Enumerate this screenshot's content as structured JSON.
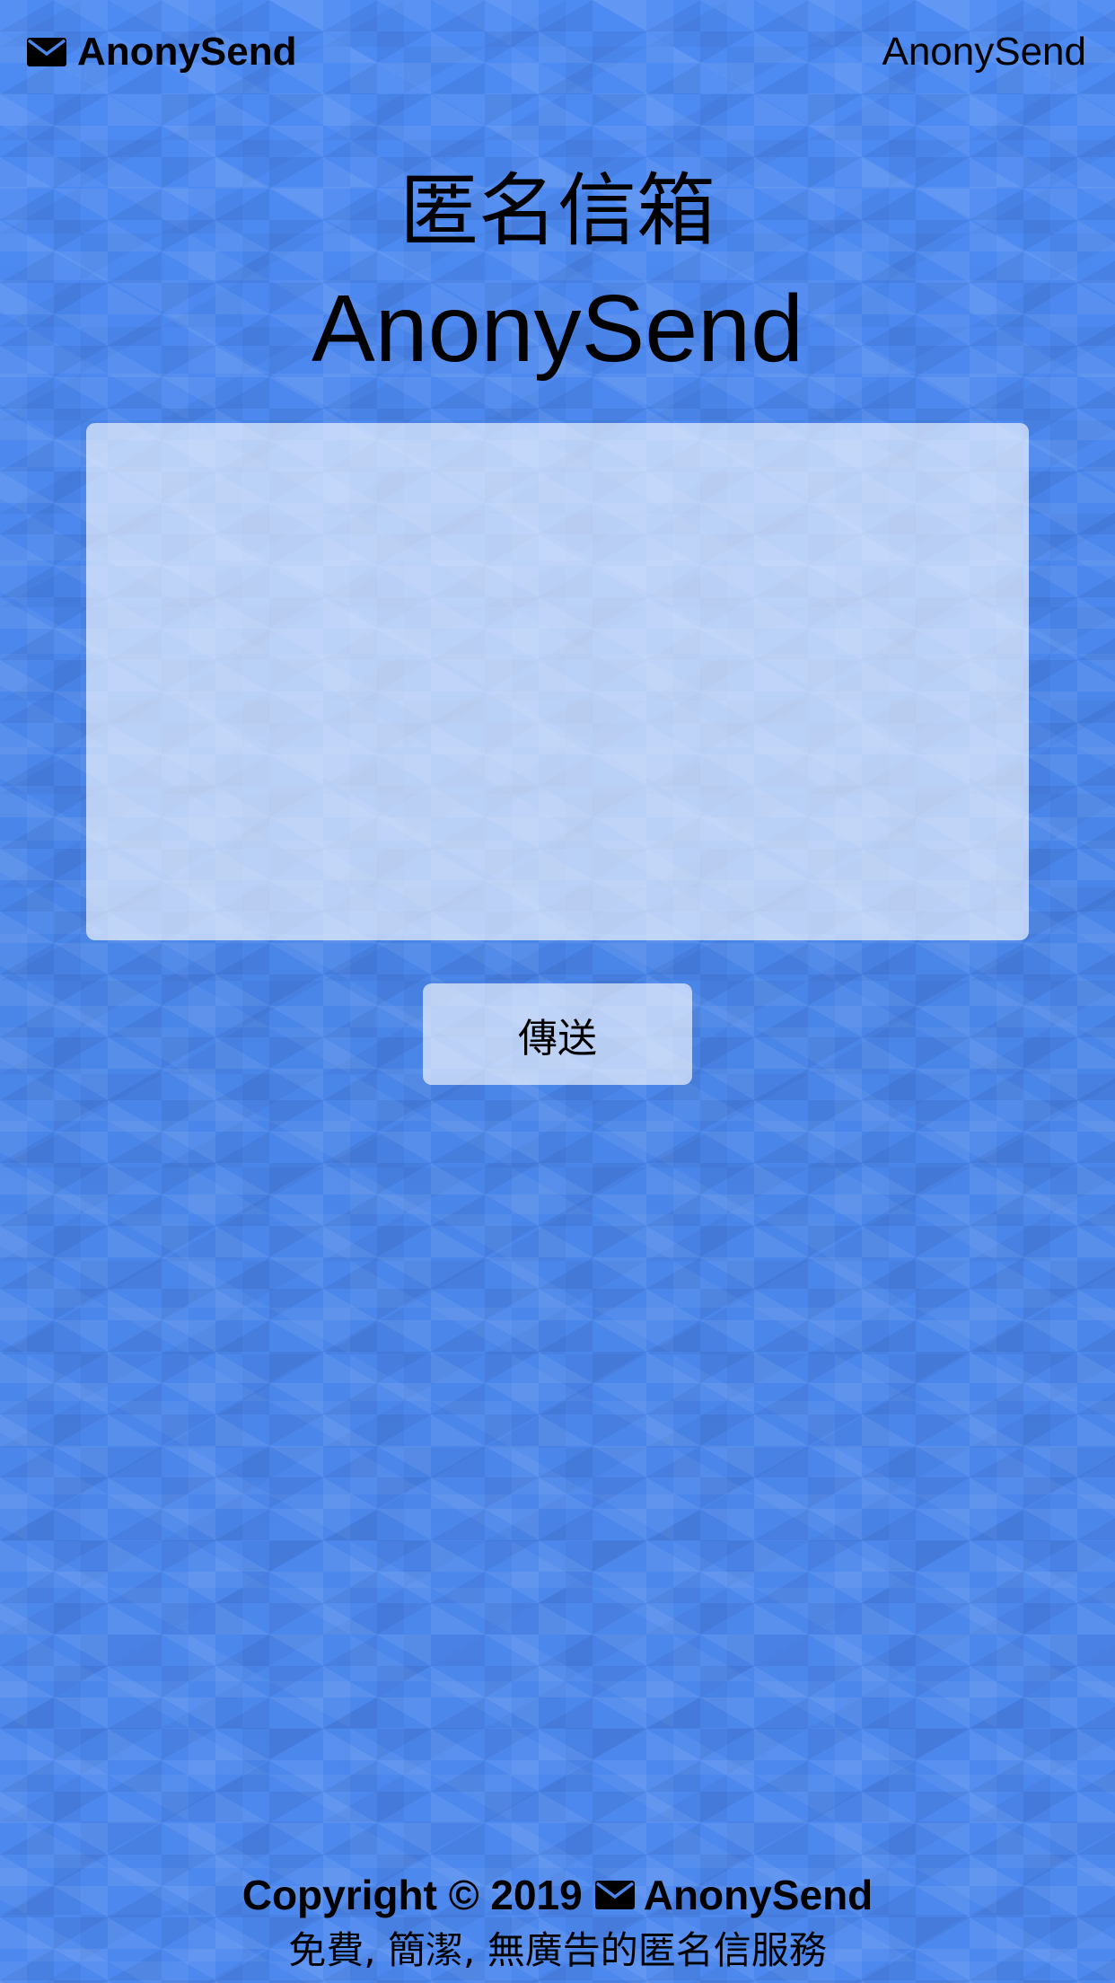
{
  "navbar": {
    "brand_label": "AnonySend",
    "brand_icon": "envelope-icon",
    "link_label": "AnonySend"
  },
  "hero": {
    "title": "匿名信箱",
    "subtitle": "AnonySend"
  },
  "form": {
    "message_value": "",
    "send_label": "傳送"
  },
  "footer": {
    "copyright": "Copyright © 2019",
    "brand_label": "AnonySend",
    "tagline": "免費, 簡潔, 無廣告的匿名信服務"
  },
  "colors": {
    "background": "#4b86ea",
    "text": "#000000",
    "panel": "rgba(255,255,255,0.62)"
  }
}
